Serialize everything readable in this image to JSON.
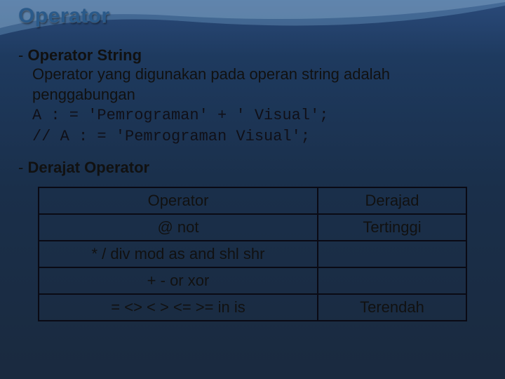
{
  "title": "Operator",
  "section1": {
    "dash": "-",
    "heading": "Operator String",
    "body": "Operator yang digunakan pada operan string adalah penggabungan",
    "code1": "A : = 'Pemrograman' + ' Visual';",
    "code2": "// A : = 'Pemrograman Visual';"
  },
  "section2": {
    "dash": "-",
    "heading": "Derajat Operator"
  },
  "table": {
    "rows": [
      {
        "col1": "Operator",
        "col2": "Derajad"
      },
      {
        "col1": "@ not",
        "col2": "Tertinggi"
      },
      {
        "col1": "* / div mod as and shl shr",
        "col2": ""
      },
      {
        "col1": "+ - or xor",
        "col2": ""
      },
      {
        "col1": "= <> < > <= >= in is",
        "col2": "Terendah"
      }
    ]
  }
}
